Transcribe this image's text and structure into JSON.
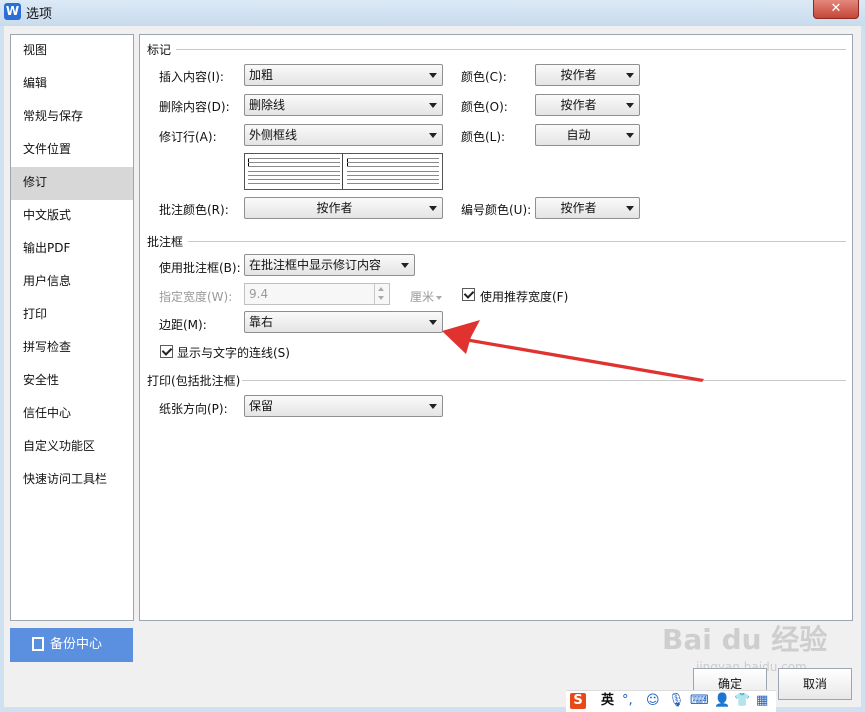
{
  "window": {
    "title": "选项",
    "close_glyph": "✕"
  },
  "sidebar": {
    "items": [
      {
        "label": "视图"
      },
      {
        "label": "编辑"
      },
      {
        "label": "常规与保存"
      },
      {
        "label": "文件位置"
      },
      {
        "label": "修订",
        "active": true
      },
      {
        "label": "中文版式"
      },
      {
        "label": "输出PDF"
      },
      {
        "label": "用户信息"
      },
      {
        "label": "打印"
      },
      {
        "label": "拼写检查"
      },
      {
        "label": "安全性"
      },
      {
        "label": "信任中心"
      },
      {
        "label": "自定义功能区"
      },
      {
        "label": "快速访问工具栏"
      }
    ],
    "backup_label": "备份中心"
  },
  "markup": {
    "title": "标记",
    "insert_label": "插入内容(I):",
    "insert_value": "加粗",
    "insert_color_label": "颜色(C):",
    "insert_color_value": "按作者",
    "delete_label": "删除内容(D):",
    "delete_value": "删除线",
    "delete_color_label": "颜色(O):",
    "delete_color_value": "按作者",
    "revline_label": "修订行(A):",
    "revline_value": "外侧框线",
    "revline_color_label": "颜色(L):",
    "revline_color_value": "自动",
    "comment_color_label": "批注颜色(R):",
    "comment_color_value": "按作者",
    "numbering_color_label": "编号颜色(U):",
    "numbering_color_value": "按作者"
  },
  "balloon": {
    "title": "批注框",
    "use_label": "使用批注框(B):",
    "use_value": "在批注框中显示修订内容",
    "width_label": "指定宽度(W):",
    "width_value": "9.4",
    "width_unit": "厘米",
    "recommended_label": "使用推荐宽度(F)",
    "recommended_checked": true,
    "margin_label": "边距(M):",
    "margin_value": "靠右",
    "show_lines_label": "显示与文字的连线(S)",
    "show_lines_checked": true
  },
  "print": {
    "title": "打印(包括批注框)",
    "orientation_label": "纸张方向(P):",
    "orientation_value": "保留"
  },
  "footer": {
    "ok_label": "确定",
    "cancel_label": "取消"
  },
  "taskbar_ime": {
    "mode_label": "英"
  },
  "watermark": {
    "text": "Bai du 经验",
    "sub": "jingyan.baidu.com"
  },
  "colors": {
    "accent_blue": "#5b8fe0",
    "arrow_red": "#e0332f"
  }
}
